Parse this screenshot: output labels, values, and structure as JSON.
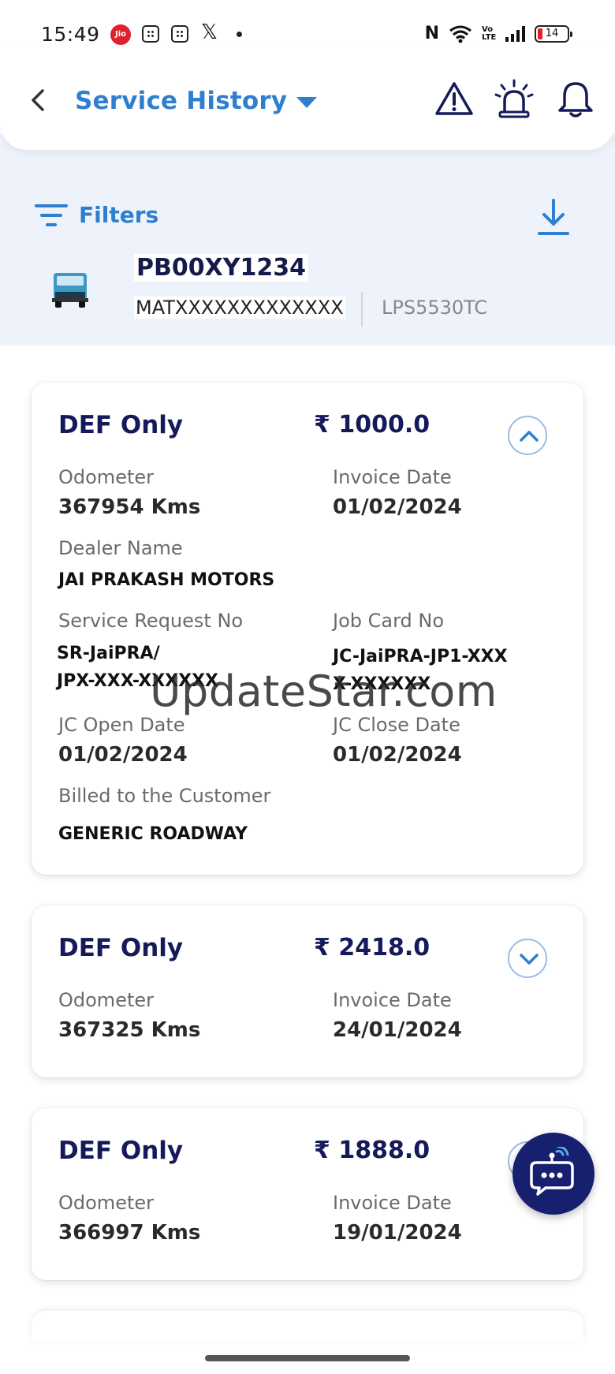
{
  "status_bar": {
    "time": "15:49",
    "carrier_badge": "Jio",
    "x_app": "𝕏",
    "nfc": "N",
    "volte": "Vo LTE",
    "battery": "14"
  },
  "header": {
    "title": "Service History",
    "icons": [
      "back-icon",
      "chevron-down-icon",
      "warning-icon",
      "alarm-siren-icon",
      "bell-icon"
    ]
  },
  "filters": {
    "label": "Filters",
    "download_icon": "download-icon"
  },
  "vehicle": {
    "registration": "PB00XY1234",
    "chassis": "MATXXXXXXXXXXXXX",
    "model": "LPS5530TC"
  },
  "labels": {
    "odometer": "Odometer",
    "invoice_date": "Invoice Date",
    "dealer_name": "Dealer Name",
    "service_request_no": "Service Request No",
    "job_card_no": "Job Card No",
    "jc_open_date": "JC Open Date",
    "jc_close_date": "JC Close Date",
    "billed_to": "Billed to the Customer"
  },
  "records": [
    {
      "title": "DEF Only",
      "amount": "₹ 1000.0",
      "odometer": "367954 Kms",
      "invoice_date": "01/02/2024",
      "dealer_name": "JAI PRAKASH MOTORS",
      "service_request_no_line1": "SR-JaiPRA/",
      "service_request_no_line2": "JPX-XXX-XXXXXX",
      "job_card_no_line1": "JC-JaiPRA-JP1-XXX",
      "job_card_no_line2": "X-XXXXXX",
      "jc_open_date": "01/02/2024",
      "jc_close_date": "01/02/2024",
      "billed_to": "GENERIC ROADWAY",
      "expanded": true
    },
    {
      "title": "DEF Only",
      "amount": "₹ 2418.0",
      "odometer": "367325 Kms",
      "invoice_date": "24/01/2024",
      "expanded": false
    },
    {
      "title": "DEF Only",
      "amount": "₹ 1888.0",
      "odometer": "366997 Kms",
      "invoice_date": "19/01/2024",
      "expanded": false
    }
  ],
  "watermark": "UpdateStar.com",
  "fab_icon": "chatbot-icon",
  "colors": {
    "accent": "#2f7fd0",
    "navy": "#141a5a",
    "fab": "#16206e",
    "section_bg": "#eef3fb"
  }
}
